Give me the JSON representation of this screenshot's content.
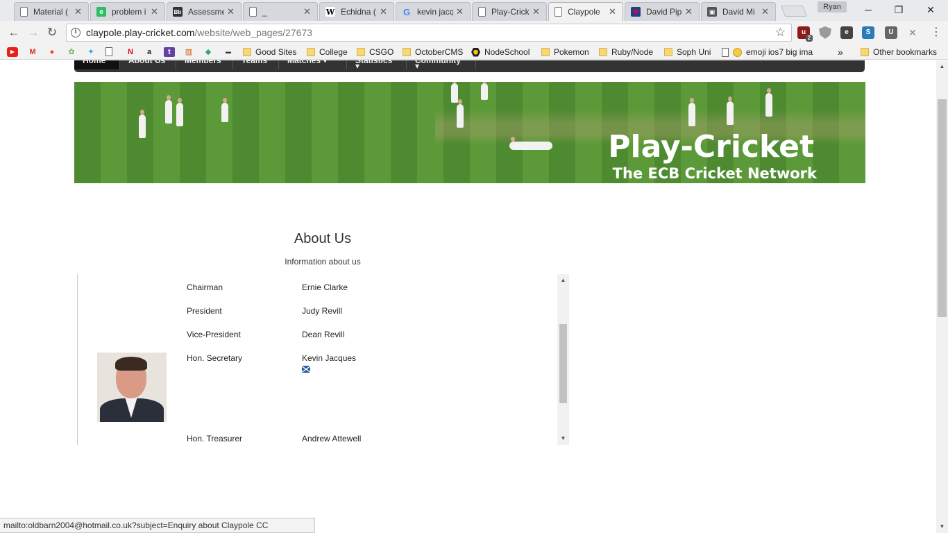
{
  "tabs": [
    {
      "title": "Material (",
      "icon": "doc-icon",
      "color": "#666666"
    },
    {
      "title": "problem i",
      "icon": "evernote-icon",
      "color": "#2dbe60"
    },
    {
      "title": "Assessme",
      "icon": "blackboard-icon",
      "color": "#333333"
    },
    {
      "title": "_",
      "icon": "doc-icon",
      "color": "#666666"
    },
    {
      "title": "Echidna (",
      "icon": "wikipedia-icon",
      "color": "#000000"
    },
    {
      "title": "kevin jacq",
      "icon": "google-icon",
      "color": "#4285f4"
    },
    {
      "title": "Play-Crick",
      "icon": "doc-icon",
      "color": "#666666"
    },
    {
      "title": "Claypole",
      "icon": "doc-icon",
      "color": "#666666",
      "active": true
    },
    {
      "title": "David Pip",
      "icon": "uk-flag-icon",
      "color": "#c8102e"
    },
    {
      "title": "David Mi",
      "icon": "parliament-icon",
      "color": "#444444"
    }
  ],
  "profile_name": "Ryan",
  "window_controls": {
    "minimize": "─",
    "restore": "❐",
    "close": "✕"
  },
  "address": {
    "host": "claypole.play-cricket.com",
    "path": "/website/web_pages/27673"
  },
  "extension_badge": "2",
  "bookmarks": [
    {
      "label": "Good Sites",
      "type": "folder"
    },
    {
      "label": "College",
      "type": "folder"
    },
    {
      "label": "CSGO",
      "type": "folder"
    },
    {
      "label": "OctoberCMS",
      "type": "folder"
    },
    {
      "label": "NodeSchool",
      "type": "hex"
    },
    {
      "label": "Pokemon",
      "type": "folder"
    },
    {
      "label": "Ruby/Node",
      "type": "folder"
    },
    {
      "label": "Soph Uni",
      "type": "folder"
    },
    {
      "label": "emoji ios7 big ima",
      "type": "emoji"
    }
  ],
  "bookmarks_overflow": "»",
  "other_bookmarks": "Other bookmarks",
  "site_nav": [
    "Home",
    "About Us",
    "Members",
    "Teams",
    "Matches ▾",
    "Statistics ▾",
    "Community ▾"
  ],
  "banner": {
    "title": "Play-Cricket",
    "subtitle": "The ECB Cricket Network"
  },
  "about": {
    "title": "About Us",
    "subtitle": "Information about us"
  },
  "officers": [
    {
      "role": "Chairman",
      "name": "Ernie Clarke"
    },
    {
      "role": "President",
      "name": "Judy Revill"
    },
    {
      "role": "Vice-President",
      "name": "Dean Revill"
    },
    {
      "role": "Hon. Secretary",
      "name": "Kevin Jacques",
      "has_email": true,
      "has_photo": true
    },
    {
      "role": "Hon. Treasurer",
      "name": "Andrew Attewell"
    }
  ],
  "status_url": "mailto:oldbarn2004@hotmail.co.uk?subject=Enquiry about Claypole CC"
}
